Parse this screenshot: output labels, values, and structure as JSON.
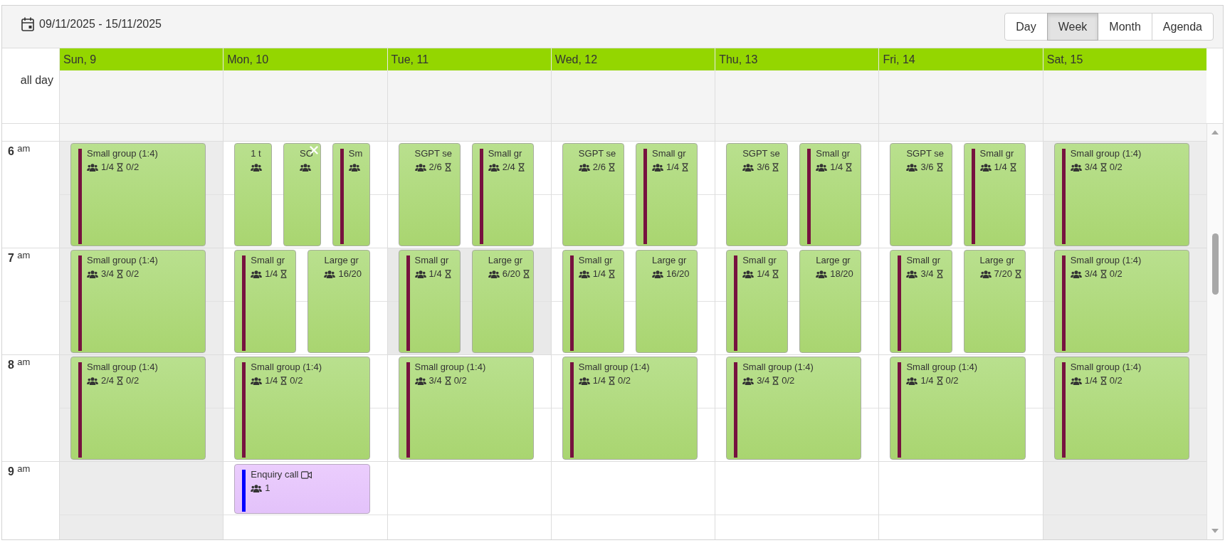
{
  "toolbar": {
    "date_range": "09/11/2025 - 15/11/2025",
    "views": [
      {
        "label": "Day",
        "selected": false
      },
      {
        "label": "Week",
        "selected": true
      },
      {
        "label": "Month",
        "selected": false
      },
      {
        "label": "Agenda",
        "selected": false
      }
    ]
  },
  "all_day_label": "all day",
  "hours": [
    "**6** $^{am}$",
    "**7** $^{am}$",
    "**8** $^{am}$",
    "**9** $^{am}$"
  ],
  "days": [
    {
      "label": "Sun, 9",
      "shaded": true,
      "slots": [
        {
          "shaded": false,
          "events": [
            {
              "kind": "class",
              "title": "Small group (1:4)",
              "color": "#76123f",
              "booked": "1/4",
              "hourglass": true,
              "waitlist": "0/2",
              "closable": false
            }
          ]
        },
        {
          "shaded": false,
          "events": [
            {
              "kind": "class",
              "title": "Small group (1:4)",
              "color": "#76123f",
              "booked": "3/4",
              "hourglass": true,
              "waitlist": "0/2",
              "closable": false
            }
          ]
        },
        {
          "shaded": false,
          "events": [
            {
              "kind": "class",
              "title": "Small group (1:4)",
              "color": "#76123f",
              "booked": "2/4",
              "hourglass": true,
              "waitlist": "0/2",
              "closable": false
            }
          ]
        },
        {
          "shaded": false
        }
      ]
    },
    {
      "label": "Mon, 10",
      "shaded": false,
      "slots": [
        {
          "shaded": false,
          "events": [
            {
              "kind": "class",
              "title": "1 t",
              "hourglass": false,
              "closable": false
            },
            {
              "kind": "class",
              "title": "SG",
              "hourglass": false,
              "closable": true
            },
            {
              "kind": "class",
              "title": "Sm",
              "color": "#76123f",
              "hourglass": false,
              "closable": false
            }
          ]
        },
        {
          "shaded": false,
          "events": [
            {
              "kind": "class",
              "title": "Small gr",
              "color": "#76123f",
              "booked": "1/4",
              "hourglass": true,
              "closable": false
            },
            {
              "kind": "class",
              "title": "Large gr",
              "booked": "16/20",
              "hourglass": false,
              "closable": false
            }
          ]
        },
        {
          "shaded": false,
          "events": [
            {
              "kind": "class",
              "title": "Small group (1:4)",
              "color": "#76123f",
              "booked": "1/4",
              "hourglass": true,
              "waitlist": "0/2",
              "closable": false
            }
          ]
        },
        {
          "shaded": false,
          "events": [
            {
              "kind": "call",
              "title": "Enquiry call",
              "color": "#0000ff",
              "booked": "1",
              "hourglass": false,
              "closable": false
            }
          ]
        }
      ]
    },
    {
      "label": "Tue, 11",
      "shaded": false,
      "slots": [
        {
          "shaded": false,
          "events": [
            {
              "kind": "class",
              "title": "SGPT se",
              "booked": "2/6",
              "hourglass": true,
              "closable": false
            },
            {
              "kind": "class",
              "title": "Small gr",
              "color": "#76123f",
              "booked": "2/4",
              "hourglass": true,
              "closable": false
            }
          ]
        },
        {
          "shaded": true,
          "events": [
            {
              "kind": "class",
              "title": "Small gr",
              "color": "#76123f",
              "booked": "1/4",
              "hourglass": true,
              "closable": false
            },
            {
              "kind": "class",
              "title": "Large gr",
              "booked": "6/20",
              "hourglass": true,
              "closable": false
            }
          ]
        },
        {
          "shaded": false,
          "events": [
            {
              "kind": "class",
              "title": "Small group (1:4)",
              "color": "#76123f",
              "booked": "3/4",
              "hourglass": true,
              "waitlist": "0/2",
              "closable": false
            }
          ]
        },
        {
          "shaded": false
        }
      ]
    },
    {
      "label": "Wed, 12",
      "shaded": false,
      "slots": [
        {
          "shaded": false,
          "events": [
            {
              "kind": "class",
              "title": "SGPT se",
              "booked": "2/6",
              "hourglass": true,
              "closable": false
            },
            {
              "kind": "class",
              "title": "Small gr",
              "color": "#76123f",
              "booked": "1/4",
              "hourglass": true,
              "closable": false
            }
          ]
        },
        {
          "shaded": false,
          "events": [
            {
              "kind": "class",
              "title": "Small gr",
              "color": "#76123f",
              "booked": "1/4",
              "hourglass": true,
              "closable": false
            },
            {
              "kind": "class",
              "title": "Large gr",
              "booked": "16/20",
              "hourglass": false,
              "closable": false
            }
          ]
        },
        {
          "shaded": false,
          "events": [
            {
              "kind": "class",
              "title": "Small group (1:4)",
              "color": "#76123f",
              "booked": "1/4",
              "hourglass": true,
              "waitlist": "0/2",
              "closable": false
            }
          ]
        },
        {
          "shaded": false
        }
      ]
    },
    {
      "label": "Thu, 13",
      "shaded": false,
      "slots": [
        {
          "shaded": false,
          "events": [
            {
              "kind": "class",
              "title": "SGPT se",
              "booked": "3/6",
              "hourglass": true,
              "closable": false
            },
            {
              "kind": "class",
              "title": "Small gr",
              "color": "#76123f",
              "booked": "1/4",
              "hourglass": true,
              "closable": false
            }
          ]
        },
        {
          "shaded": false,
          "events": [
            {
              "kind": "class",
              "title": "Small gr",
              "color": "#76123f",
              "booked": "1/4",
              "hourglass": true,
              "closable": false
            },
            {
              "kind": "class",
              "title": "Large gr",
              "booked": "18/20",
              "hourglass": false,
              "closable": false
            }
          ]
        },
        {
          "shaded": false,
          "events": [
            {
              "kind": "class",
              "title": "Small group (1:4)",
              "color": "#76123f",
              "booked": "3/4",
              "hourglass": true,
              "waitlist": "0/2",
              "closable": false
            }
          ]
        },
        {
          "shaded": false
        }
      ]
    },
    {
      "label": "Fri, 14",
      "shaded": false,
      "slots": [
        {
          "shaded": false,
          "events": [
            {
              "kind": "class",
              "title": "SGPT se",
              "booked": "3/6",
              "hourglass": true,
              "closable": false
            },
            {
              "kind": "class",
              "title": "Small gr",
              "color": "#76123f",
              "booked": "1/4",
              "hourglass": true,
              "closable": false
            }
          ]
        },
        {
          "shaded": false,
          "events": [
            {
              "kind": "class",
              "title": "Small gr",
              "color": "#76123f",
              "booked": "3/4",
              "hourglass": true,
              "closable": false
            },
            {
              "kind": "class",
              "title": "Large gr",
              "booked": "7/20",
              "hourglass": true,
              "closable": false
            }
          ]
        },
        {
          "shaded": false,
          "events": [
            {
              "kind": "class",
              "title": "Small group (1:4)",
              "color": "#76123f",
              "booked": "1/4",
              "hourglass": true,
              "waitlist": "0/2",
              "closable": false
            }
          ]
        },
        {
          "shaded": false
        }
      ]
    },
    {
      "label": "Sat, 15",
      "shaded": true,
      "slots": [
        {
          "shaded": false,
          "events": [
            {
              "kind": "class",
              "title": "Small group (1:4)",
              "color": "#76123f",
              "booked": "3/4",
              "hourglass": true,
              "waitlist": "0/2",
              "closable": false
            }
          ]
        },
        {
          "shaded": false,
          "events": [
            {
              "kind": "class",
              "title": "Small group (1:4)",
              "color": "#76123f",
              "booked": "3/4",
              "hourglass": true,
              "waitlist": "0/2",
              "closable": false
            }
          ]
        },
        {
          "shaded": false,
          "events": [
            {
              "kind": "class",
              "title": "Small group (1:4)",
              "color": "#76123f",
              "booked": "1/4",
              "hourglass": true,
              "waitlist": "0/2",
              "closable": false
            }
          ]
        },
        {
          "shaded": false
        }
      ]
    }
  ]
}
